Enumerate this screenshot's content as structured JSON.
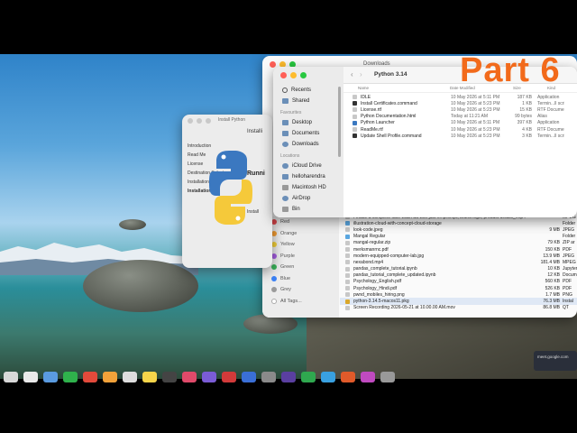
{
  "overlay_title": "Part 6",
  "installer": {
    "title": "Install Python",
    "steps": [
      "Introduction",
      "Read Me",
      "License",
      "Destination Select",
      "Installation Type",
      "Installation"
    ],
    "heading": "Installi",
    "status": "Runni",
    "sub": "Install"
  },
  "back_finder": {
    "title": "Downloads",
    "rows": [
      {
        "name": "I made a complete face wash ad with just o...prompt, brand logo, product details_.mp4",
        "size": "",
        "kind": "MPEG"
      },
      {
        "name": "illustration-cloud-with-concept-cloud-storage",
        "size": "",
        "kind": "Folder"
      },
      {
        "name": "look-code.jpeg",
        "size": "9 MB",
        "kind": "JPEG"
      },
      {
        "name": "Mangal Regular",
        "size": "",
        "kind": "Folder"
      },
      {
        "name": "mangal-regular.zip",
        "size": "79 KB",
        "kind": "ZIP ar"
      },
      {
        "name": "merksmanrnc.pdf",
        "size": "150 KB",
        "kind": "PDF"
      },
      {
        "name": "modern-equipped-computer-lab.jpg",
        "size": "13.9 MB",
        "kind": "JPEG"
      },
      {
        "name": "nexabond.mp4",
        "size": "181.4 MB",
        "kind": "MPEG"
      },
      {
        "name": "pandas_complete_tutorial.ipynb",
        "size": "10 KB",
        "kind": "Jupyter"
      },
      {
        "name": "pandas_tutorial_complete_updated.ipynb",
        "size": "12 KB",
        "kind": "Docum"
      },
      {
        "name": "Psychology_English.pdf",
        "size": "560 KB",
        "kind": "PDF"
      },
      {
        "name": "Psychology_Hindi.pdf",
        "size": "526 KB",
        "kind": "PDF"
      },
      {
        "name": "pwnd_mobiles_hiring.png",
        "size": "1.7 MB",
        "kind": "PNG"
      },
      {
        "name": "python-3.14.5-macos11.pkg",
        "size": "76.3 MB",
        "kind": "Instal"
      },
      {
        "name": "Screen Recording 2026-05-21 at 10.00.00 AM.mov",
        "size": "86.8 MB",
        "kind": "QT"
      }
    ],
    "tags": [
      {
        "label": "Red",
        "color": "#e5484d"
      },
      {
        "label": "Orange",
        "color": "#f39c33"
      },
      {
        "label": "Yellow",
        "color": "#f2cf3a"
      },
      {
        "label": "Green",
        "color": "#3ab25a"
      },
      {
        "label": "Purple",
        "color": "#a45de0"
      },
      {
        "label": "Blue",
        "color": "#3b82f6"
      },
      {
        "label": "Grey",
        "color": "#9a9a9a"
      },
      {
        "label": "All Tags...",
        "color": "#ffffff"
      }
    ]
  },
  "front_finder": {
    "title": "Python 3.14",
    "sidebar_top": [
      "Recents",
      "Shared"
    ],
    "favourites_label": "Favourites",
    "favourites": [
      "Desktop",
      "Documents",
      "Downloads"
    ],
    "locations_label": "Locations",
    "locations": [
      "iCloud Drive",
      "helloharendra",
      "Macintosh HD",
      "AirDrop",
      "Bin"
    ],
    "columns": {
      "name": "Name",
      "date": "Date Modified",
      "size": "Size",
      "kind": "Kind"
    },
    "files": [
      {
        "name": "IDLE",
        "date": "10 May 2026 at 5:11 PM",
        "size": "187 KB",
        "kind": "Application"
      },
      {
        "name": "Install Certificates.command",
        "date": "10 May 2026 at 5:23 PM",
        "size": "1 KB",
        "kind": "Termin...ll script"
      },
      {
        "name": "License.rtf",
        "date": "10 May 2026 at 5:23 PM",
        "size": "15 KB",
        "kind": "RTF Document"
      },
      {
        "name": "Python Documentation.html",
        "date": "Today at 11:21 AM",
        "size": "99 bytes",
        "kind": "Alias"
      },
      {
        "name": "Python Launcher",
        "date": "10 May 2026 at 5:11 PM",
        "size": "397 KB",
        "kind": "Application"
      },
      {
        "name": "ReadMe.rtf",
        "date": "10 May 2026 at 5:23 PM",
        "size": "4 KB",
        "kind": "RTF Document"
      },
      {
        "name": "Update Shell Profile.command",
        "date": "10 May 2026 at 5:23 PM",
        "size": "3 KB",
        "kind": "Termin...ll script"
      }
    ]
  },
  "notification": {
    "text": "meet.google.com"
  },
  "colors": {
    "accent": "#f26a1b",
    "traffic_red": "#ff5f57",
    "traffic_yellow": "#febc2e",
    "traffic_green": "#28c840",
    "selection": "#2f6fd6"
  }
}
